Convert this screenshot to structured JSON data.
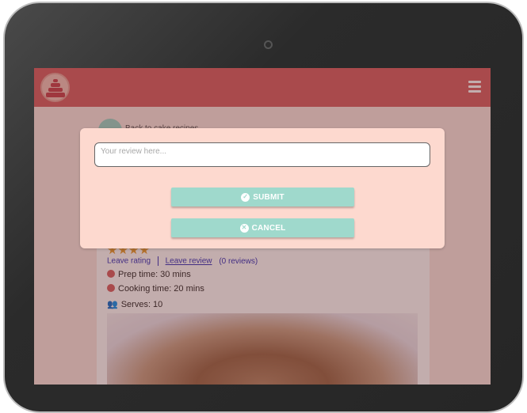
{
  "page": {
    "back_link": "Back to cake recipes",
    "review_links": {
      "leave_rating": "Leave rating",
      "leave_review": "Leave review",
      "review_count": "(0 reviews)"
    },
    "info": {
      "prep_time": "Prep time: 30 mins",
      "cooking_time": "Cooking time: 20 mins",
      "serves": "Serves: 10"
    },
    "rating_stars": 4
  },
  "modal": {
    "review_placeholder": "Your review here...",
    "submit_label": "SUBMIT",
    "cancel_label": "CANCEL"
  },
  "colors": {
    "navbar": "#d9686a",
    "accent": "#9fd9cc",
    "modal_bg": "#fdd9cf",
    "link": "#3c3cbf"
  }
}
